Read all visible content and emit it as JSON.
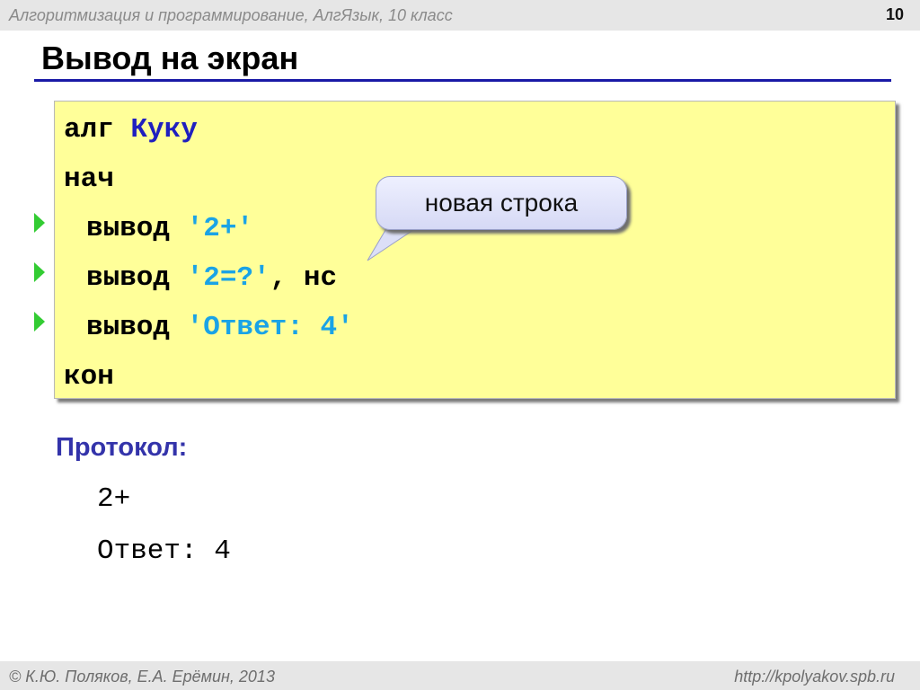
{
  "header": {
    "course": "Алгоритмизация и программирование, АлгЯзык, 10 класс",
    "page_number": "10"
  },
  "slide": {
    "title": "Вывод на экран"
  },
  "code": {
    "line1_kw": "алг ",
    "line1_name": "Куку",
    "line2": "нач",
    "line3_kw": "вывод ",
    "line3_str": "'2+'",
    "line4_kw": "вывод ",
    "line4_str": "'2=?'",
    "line4_rest": ", нс",
    "line5_kw": "вывод ",
    "line5_str": "'Ответ: 4'",
    "line6": "кон"
  },
  "callout": {
    "text": "новая строка"
  },
  "protocol": {
    "label": "Протокол:",
    "lines": [
      "2+",
      "Ответ: 4"
    ]
  },
  "footer": {
    "copyright": "© К.Ю. Поляков, Е.А. Ерёмин, 2013",
    "url": "http://kpolyakov.spb.ru"
  },
  "colors": {
    "code_background": "#ffff99",
    "keyword": "#000000",
    "algorithm_name": "#1f1fbf",
    "string_literal": "#1aa3e6",
    "title_rule": "#1a1aa6",
    "arrow": "#33cc33",
    "protocol_label": "#3333aa"
  },
  "icons": {
    "line_marker": "green-triangle-arrow-icon"
  }
}
